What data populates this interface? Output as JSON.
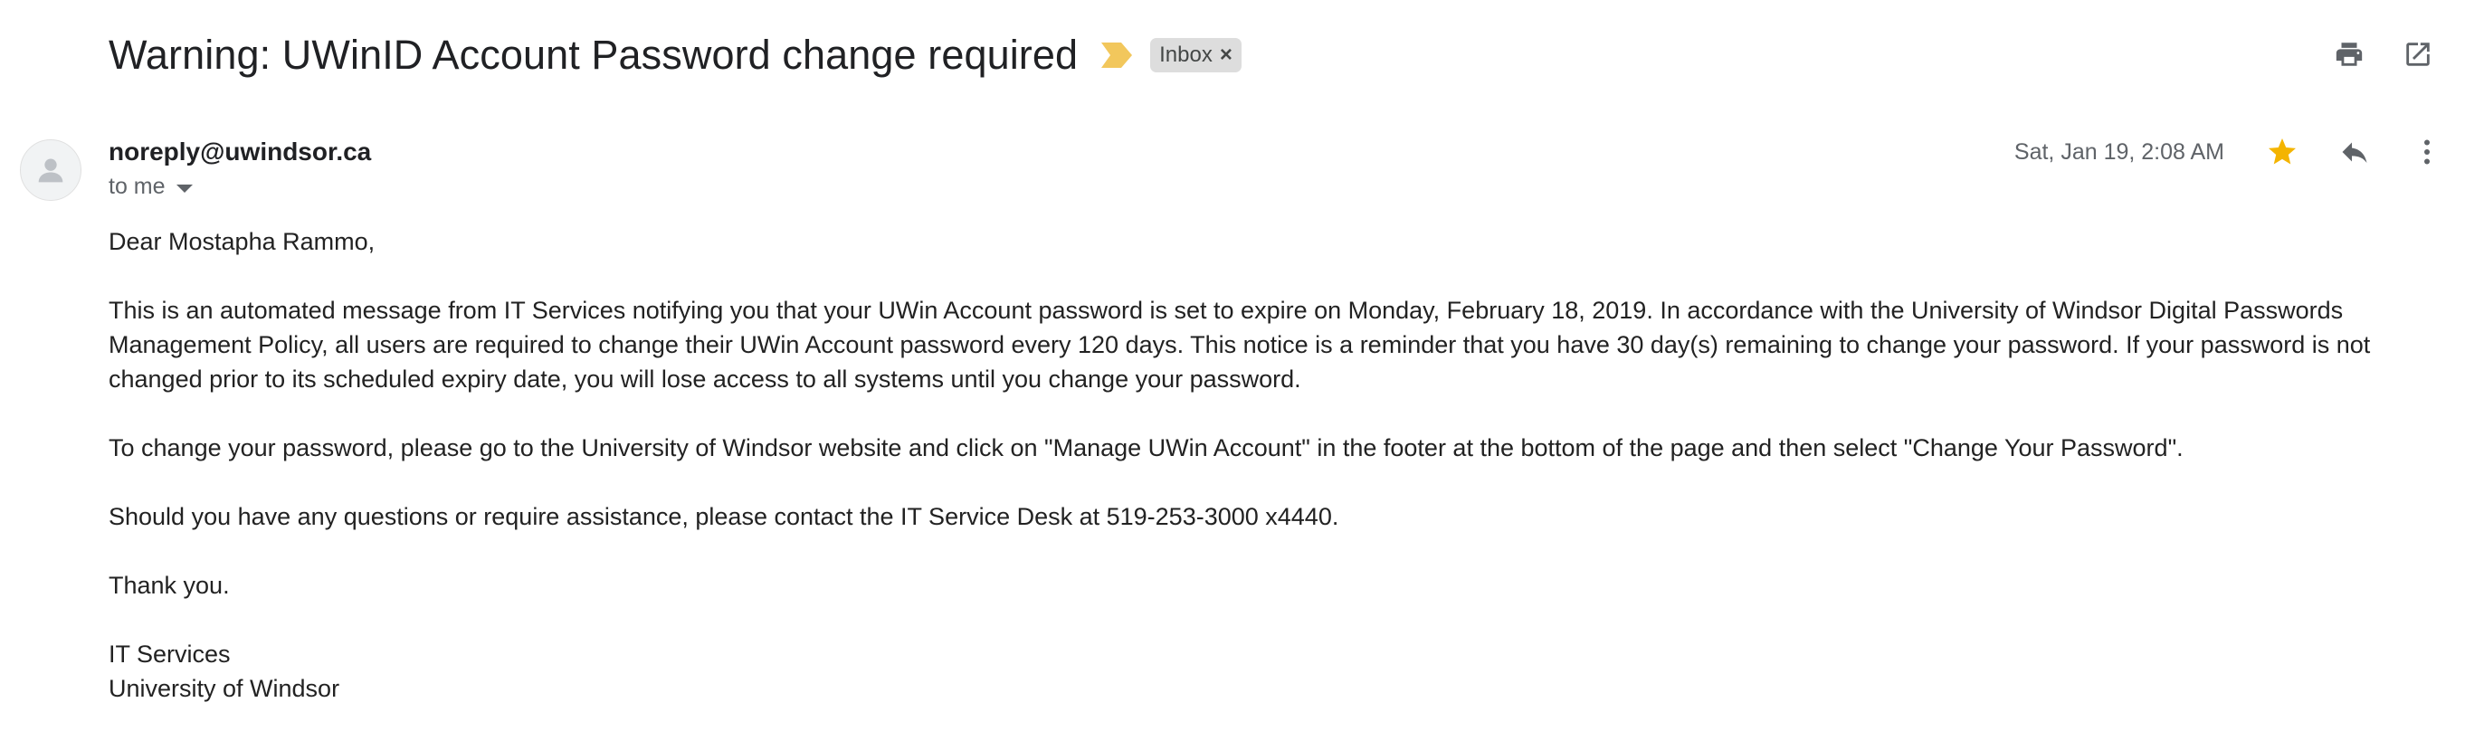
{
  "email": {
    "subject": "Warning: UWinID Account Password change required",
    "label": "Inbox",
    "label_close": "×",
    "sender": "noreply@uwindsor.ca",
    "recipient": "to me",
    "date": "Sat, Jan 19, 2:08 AM",
    "starred": true,
    "body": {
      "greeting": "Dear Mostapha Rammo,",
      "paragraph1": "This is an automated message from IT Services notifying you that your UWin Account password is set to expire on Monday, February 18, 2019. In accordance with the University of Windsor Digital Passwords Management Policy, all users are required to change their UWin Account password every 120 days. This notice is a reminder that you have 30 day(s) remaining to change your password. If your password is not changed prior to its scheduled expiry date, you will lose access to all systems until you change your password.",
      "paragraph2": "To change your password, please go to the University of Windsor website and click on \"Manage UWin Account\" in the footer at the bottom of the page and then select \"Change Your Password\".",
      "paragraph3": "Should you have any questions or require assistance, please contact the IT Service Desk at 519-253-3000 x4440.",
      "closing": "Thank you.",
      "signature_line1": "IT Services",
      "signature_line2": "University of Windsor"
    }
  },
  "icons": {
    "importance": "importance-marker-icon",
    "print": "print-icon",
    "open_new_window": "open-in-new-window-icon",
    "avatar": "default-avatar-icon",
    "star": "star-icon",
    "reply": "reply-icon",
    "more": "more-vert-icon"
  },
  "colors": {
    "importance_marker": "#f2c75c",
    "star": "#f4b400",
    "icon_gray": "#5f6368",
    "chip_bg": "#dddddd"
  }
}
